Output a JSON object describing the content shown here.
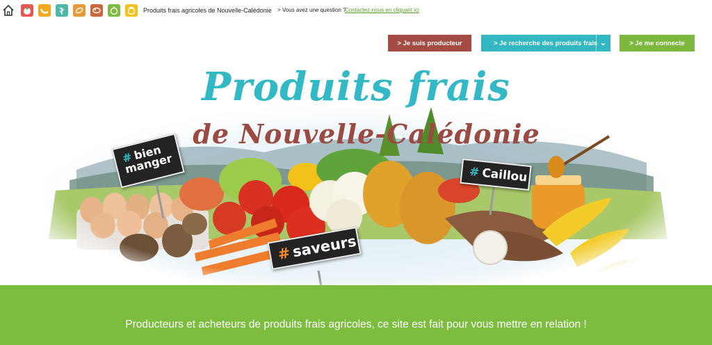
{
  "topbar": {
    "home_icon": "home-icon",
    "categories": [
      {
        "name": "tomato-icon",
        "color": "#e8564f"
      },
      {
        "name": "banana-icon",
        "color": "#f2a81d"
      },
      {
        "name": "herb-icon",
        "color": "#4db8a8"
      },
      {
        "name": "grain-icon",
        "color": "#e89a3a"
      },
      {
        "name": "meat-icon",
        "color": "#c9693b"
      },
      {
        "name": "fruit-icon",
        "color": "#7cbd3f"
      },
      {
        "name": "honey-icon",
        "color": "#f4c21e"
      }
    ],
    "site_label": "Produits frais agricoles de Nouvelle-Calédonie",
    "question": "> Vous avez une question ?",
    "contact_link": "Contactez-nous en cliquant ici"
  },
  "buttons": {
    "producer": "> Je suis producteur",
    "search": "> Je recherche des produits frais",
    "login": "> Je me connecte",
    "colors": {
      "producer": "#a44b43",
      "search": "#33b7c2",
      "login": "#7cb83d"
    }
  },
  "hero": {
    "title_line1": "Produits frais",
    "title_line2": "de Nouvelle-Calédonie",
    "tags": {
      "bien_hash": "#",
      "bien_text": "bien manger",
      "caillou_hash": "#",
      "caillou_text": "Caillou",
      "saveurs_hash": "#",
      "saveurs_text": "saveurs"
    }
  },
  "banner": {
    "text": "Producteurs et acheteurs de produits frais agricoles, ce site est fait pour vous mettre en relation !",
    "color": "#7cbd3f"
  }
}
